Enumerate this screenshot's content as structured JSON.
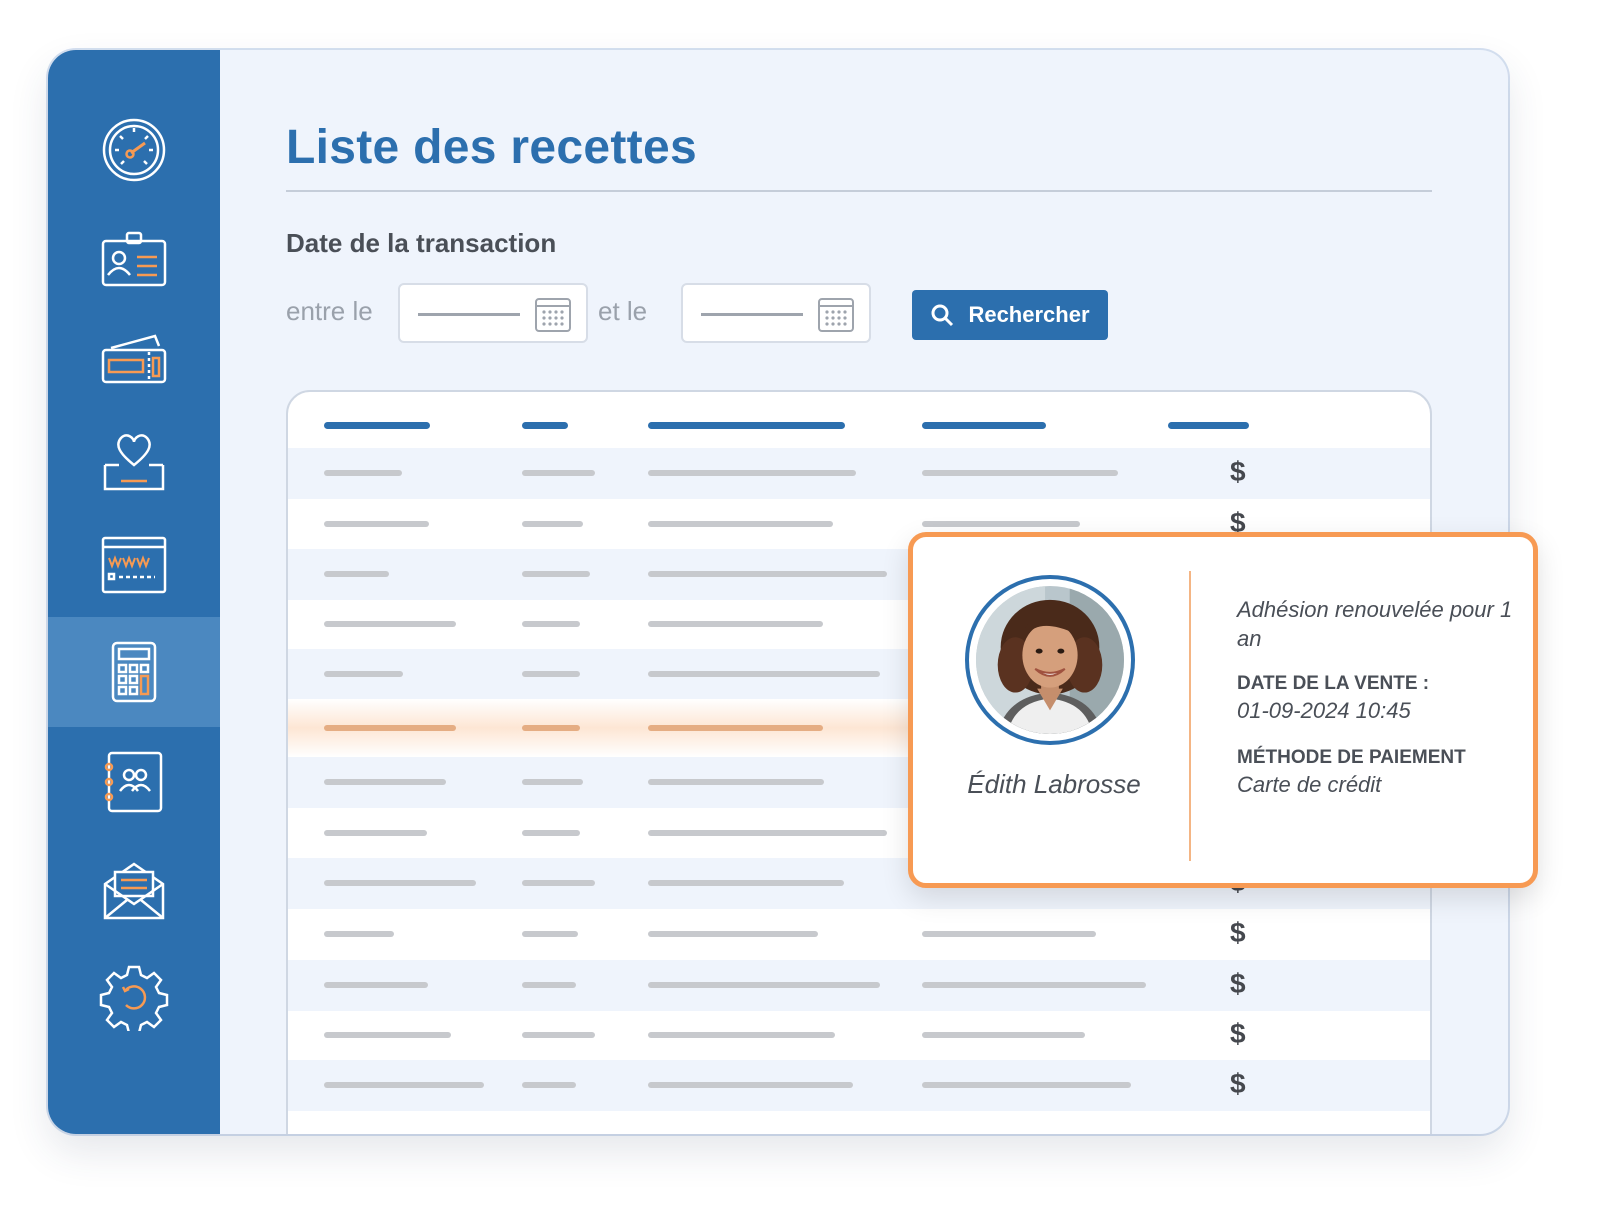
{
  "page": {
    "title": "Liste des recettes"
  },
  "sidebar": {
    "items": [
      {
        "icon": "dashboard-gauge-icon"
      },
      {
        "icon": "membership-card-icon"
      },
      {
        "icon": "tickets-icon"
      },
      {
        "icon": "donation-heart-icon"
      },
      {
        "icon": "website-icon"
      },
      {
        "icon": "calculator-icon",
        "active": true
      },
      {
        "icon": "contacts-book-icon"
      },
      {
        "icon": "mail-icon"
      },
      {
        "icon": "settings-gear-icon"
      }
    ]
  },
  "filter": {
    "label": "Date de la transaction",
    "from_label": "entre le",
    "to_label": "et le",
    "search_button": "Rechercher"
  },
  "table": {
    "currency_symbol": "$"
  },
  "popup": {
    "name": "Édith Labrosse",
    "description": "Adhésion renouvelée pour 1 an",
    "sale_date_label": "DATE DE LA VENTE :",
    "sale_date_value": "01-09-2024 10:45",
    "payment_label": "MÉTHODE DE PAIEMENT",
    "payment_value": "Carte de crédit"
  },
  "colors": {
    "brand_blue": "#2c6fae",
    "accent_orange": "#f79a53",
    "sidebar_active": "#4b88c0"
  }
}
